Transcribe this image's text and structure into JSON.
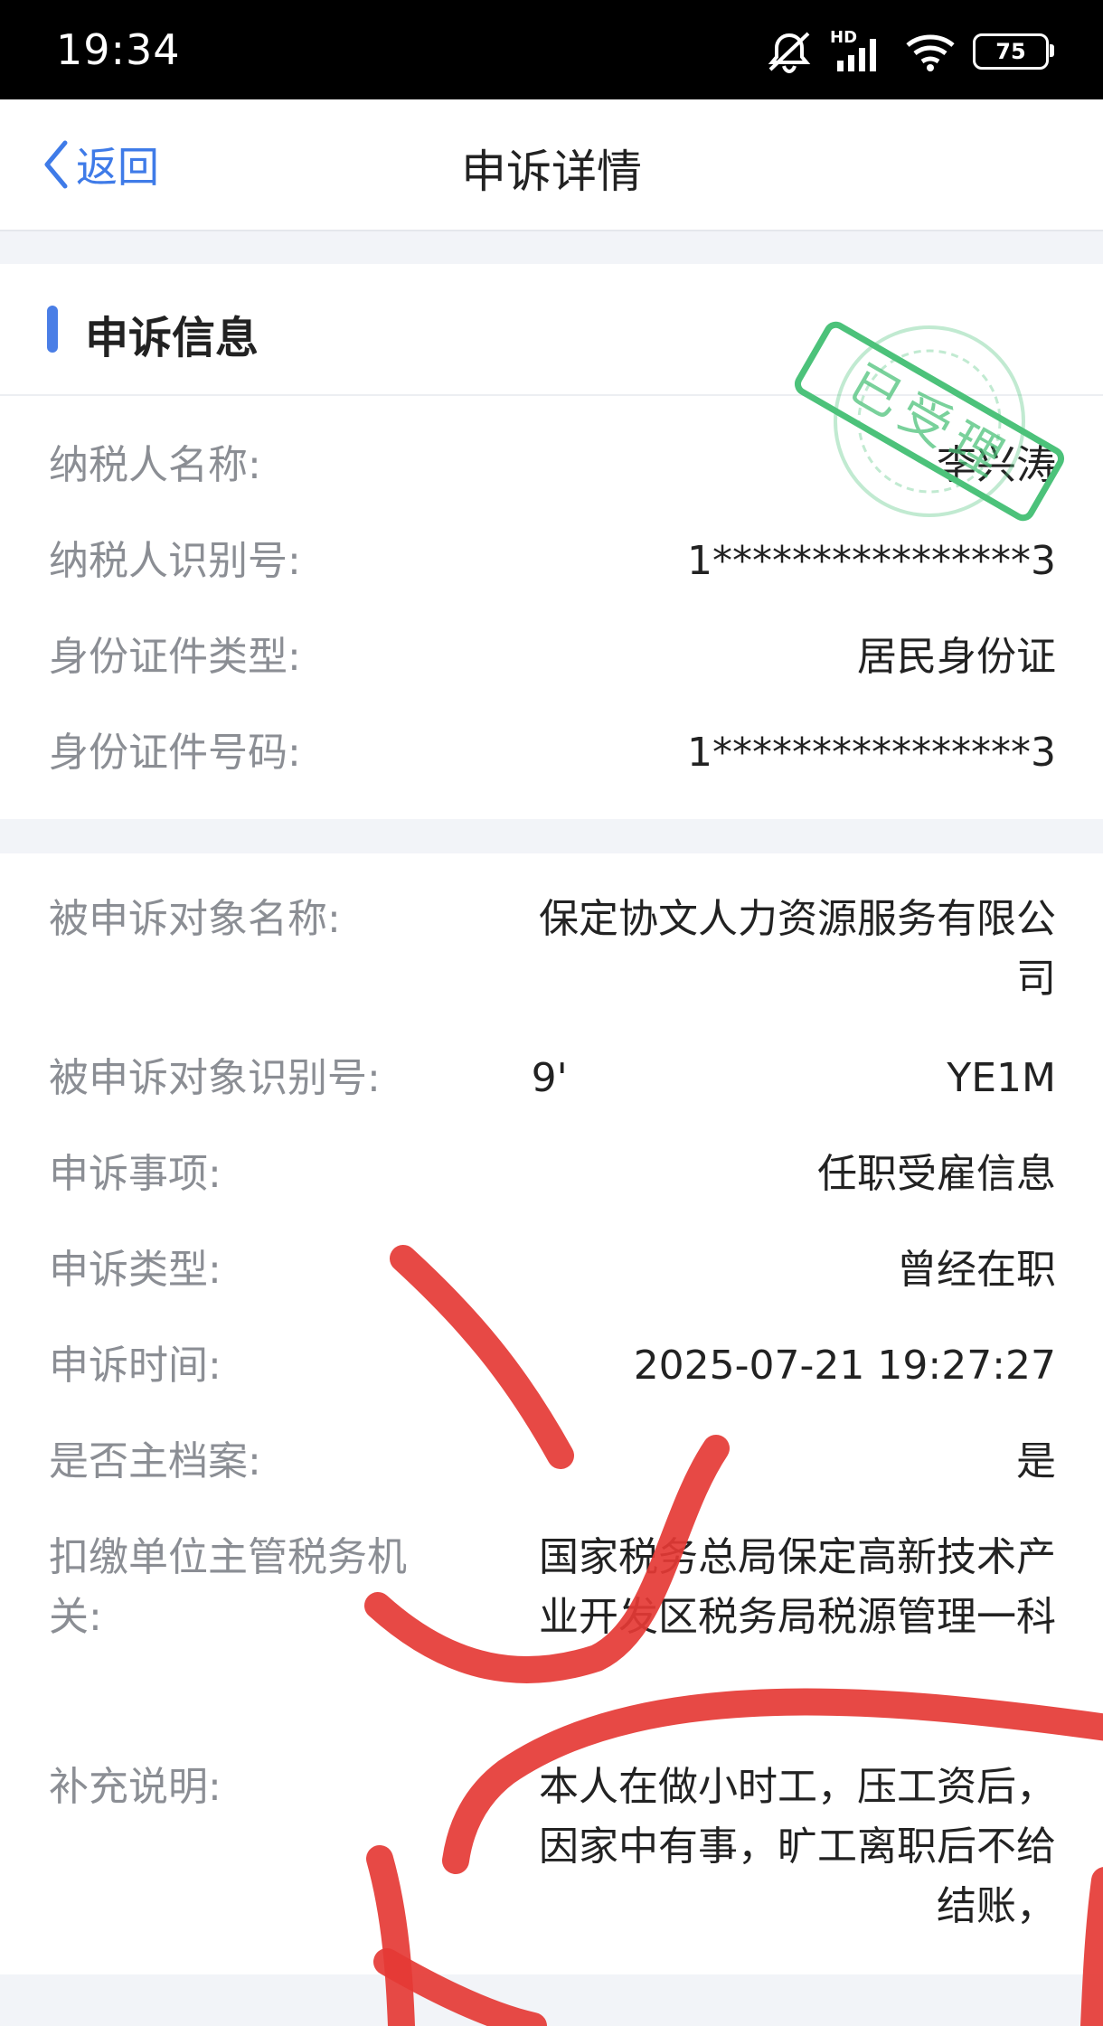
{
  "status_bar": {
    "time": "19:34",
    "network": "HD",
    "battery": "75",
    "icons": [
      "mute-icon",
      "signal-icon",
      "wifi-icon",
      "battery-icon"
    ]
  },
  "nav": {
    "back_label": "返回",
    "title": "申诉详情"
  },
  "section1": {
    "title": "申诉信息",
    "stamp_text": "已受理",
    "rows": [
      {
        "label": "纳税人名称:",
        "value": "李兴涛"
      },
      {
        "label": "纳税人识别号:",
        "value": "1****************3"
      },
      {
        "label": "身份证件类型:",
        "value": "居民身份证"
      },
      {
        "label": "身份证件号码:",
        "value": "1****************3"
      }
    ]
  },
  "section2": {
    "rows": [
      {
        "label": "被申诉对象名称:",
        "value": "保定协文人力资源服务有限公司"
      },
      {
        "label": "被申诉对象识别号:",
        "value": "9'                              YE1M"
      },
      {
        "label": "申诉事项:",
        "value": "任职受雇信息"
      },
      {
        "label": "申诉类型:",
        "value": "曾经在职"
      },
      {
        "label": "申诉时间:",
        "value": "2025-07-21 19:27:27"
      },
      {
        "label": "是否主档案:",
        "value": "是"
      },
      {
        "label": "扣缴单位主管税务机关:",
        "value": "国家税务总局保定高新技术产业开发区税务局税源管理一科"
      },
      {
        "label": "补充说明:",
        "value": "本人在做小时工，压工资后，因家中有事，旷工离职后不给结账，"
      }
    ]
  },
  "colors": {
    "accent": "#4a7ee6",
    "link": "#3f7be8",
    "stamp": "#4cc27a",
    "ink": "#e53935"
  }
}
